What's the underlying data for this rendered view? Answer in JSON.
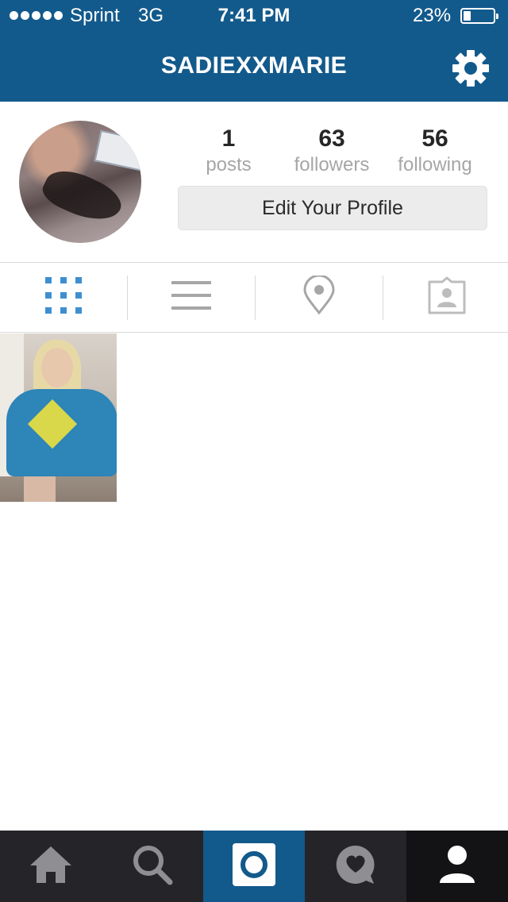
{
  "status_bar": {
    "carrier": "Sprint",
    "network": "3G",
    "time": "7:41 PM",
    "battery_percent": "23%",
    "battery_level": 0.23,
    "signal_dots": 5
  },
  "nav": {
    "title": "SADIEXXMARIE",
    "settings_icon": "gear-icon"
  },
  "profile": {
    "stats": [
      {
        "value": "1",
        "label": "posts"
      },
      {
        "value": "63",
        "label": "followers"
      },
      {
        "value": "56",
        "label": "following"
      }
    ],
    "edit_button_label": "Edit Your Profile"
  },
  "view_tabs": [
    {
      "icon": "grid-icon",
      "active": true
    },
    {
      "icon": "list-icon",
      "active": false
    },
    {
      "icon": "location-pin-icon",
      "active": false
    },
    {
      "icon": "tagged-photos-icon",
      "active": false
    }
  ],
  "posts_count_shown": 1,
  "bottom_bar": [
    {
      "icon": "home-icon"
    },
    {
      "icon": "search-icon"
    },
    {
      "icon": "camera-icon",
      "active_color": "#135a8c"
    },
    {
      "icon": "activity-heart-icon"
    },
    {
      "icon": "profile-icon",
      "active": true
    }
  ],
  "colors": {
    "brand_blue": "#135a8c",
    "tab_active": "#3f8fd0",
    "tab_inactive": "#a6a6a6",
    "bottom_bar_bg": "#252529"
  }
}
